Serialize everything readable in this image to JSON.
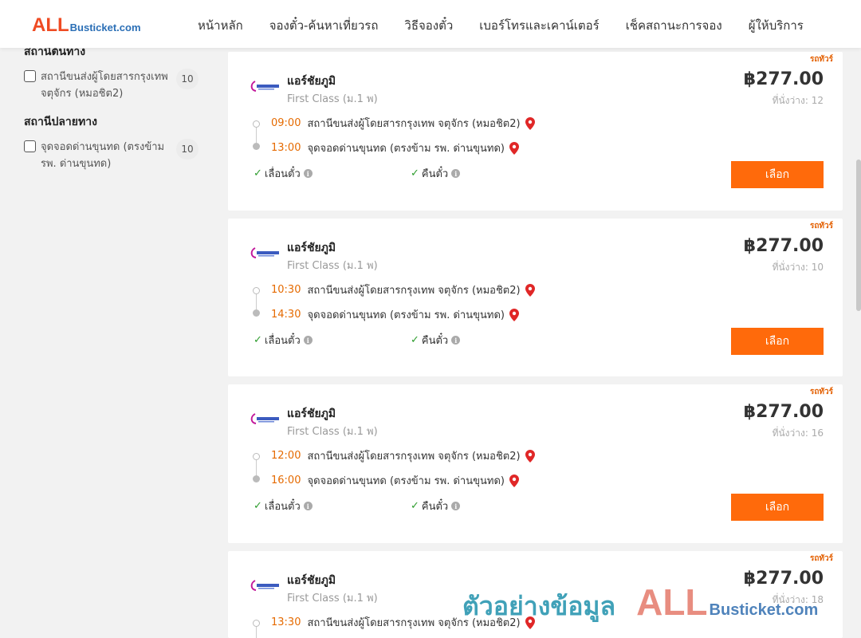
{
  "header": {
    "logo_all": "ALL",
    "logo_rest": "Busticket.com",
    "nav": [
      "หน้าหลัก",
      "จองตั๋ว-ค้นหาเที่ยวรถ",
      "วิธีจองตั๋ว",
      "เบอร์โทรและเคาน์เตอร์",
      "เช็คสถานะการจอง",
      "ผู้ให้บริการ"
    ]
  },
  "sidebar": {
    "origin_title": "สถานีต้นทาง",
    "origin_items": [
      {
        "label": "สถานีขนส่งผู้โดยสารกรุงเทพ จตุจักร (หมอชิต2)",
        "count": "10",
        "checked": false
      }
    ],
    "dest_title": "สถานีปลายทาง",
    "dest_items": [
      {
        "label": "จุดจอดด่านขุนทด (ตรงข้าม รพ. ด่านขุนทด)",
        "count": "10",
        "checked": false
      }
    ]
  },
  "trips": [
    {
      "ribbon": "รถทัวร์",
      "operator": "แอร์ชัยภูมิ",
      "class": "First Class (ม.1 พ)",
      "price": "฿277.00",
      "seats": "ที่นั่งว่าง: 12",
      "depart_time": "09:00",
      "depart_station": "สถานีขนส่งผู้โดยสารกรุงเทพ จตุจักร (หมอชิต2)",
      "arrive_time": "13:00",
      "arrive_station": "จุดจอดด่านขุนทด (ตรงข้าม รพ. ด่านขุนทด)",
      "change": "เลื่อนตั๋ว",
      "refund": "คืนตั๋ว",
      "select": "เลือก"
    },
    {
      "ribbon": "รถทัวร์",
      "operator": "แอร์ชัยภูมิ",
      "class": "First Class (ม.1 พ)",
      "price": "฿277.00",
      "seats": "ที่นั่งว่าง: 10",
      "depart_time": "10:30",
      "depart_station": "สถานีขนส่งผู้โดยสารกรุงเทพ จตุจักร (หมอชิต2)",
      "arrive_time": "14:30",
      "arrive_station": "จุดจอดด่านขุนทด (ตรงข้าม รพ. ด่านขุนทด)",
      "change": "เลื่อนตั๋ว",
      "refund": "คืนตั๋ว",
      "select": "เลือก"
    },
    {
      "ribbon": "รถทัวร์",
      "operator": "แอร์ชัยภูมิ",
      "class": "First Class (ม.1 พ)",
      "price": "฿277.00",
      "seats": "ที่นั่งว่าง: 16",
      "depart_time": "12:00",
      "depart_station": "สถานีขนส่งผู้โดยสารกรุงเทพ จตุจักร (หมอชิต2)",
      "arrive_time": "16:00",
      "arrive_station": "จุดจอดด่านขุนทด (ตรงข้าม รพ. ด่านขุนทด)",
      "change": "เลื่อนตั๋ว",
      "refund": "คืนตั๋ว",
      "select": "เลือก"
    },
    {
      "ribbon": "รถทัวร์",
      "operator": "แอร์ชัยภูมิ",
      "class": "First Class (ม.1 พ)",
      "price": "฿277.00",
      "seats": "ที่นั่งว่าง: 18",
      "depart_time": "13:30",
      "depart_station": "สถานีขนส่งผู้โดยสารกรุงเทพ จตุจักร (หมอชิต2)"
    }
  ],
  "watermark": {
    "text": "ตัวอย่างข้อมูล",
    "all": "ALL",
    "rest": "Busticket.com"
  },
  "colors": {
    "accent": "#ff6a0b",
    "time": "#e56a00",
    "check": "#2e9d2e",
    "pin": "#e02727",
    "logo_red": "#ef4b23",
    "logo_blue": "#2b6fb6"
  },
  "icons": {
    "pin": "map-pin-icon",
    "check": "check-icon",
    "info": "info-icon",
    "operator_logo": "operator-logo-icon"
  }
}
